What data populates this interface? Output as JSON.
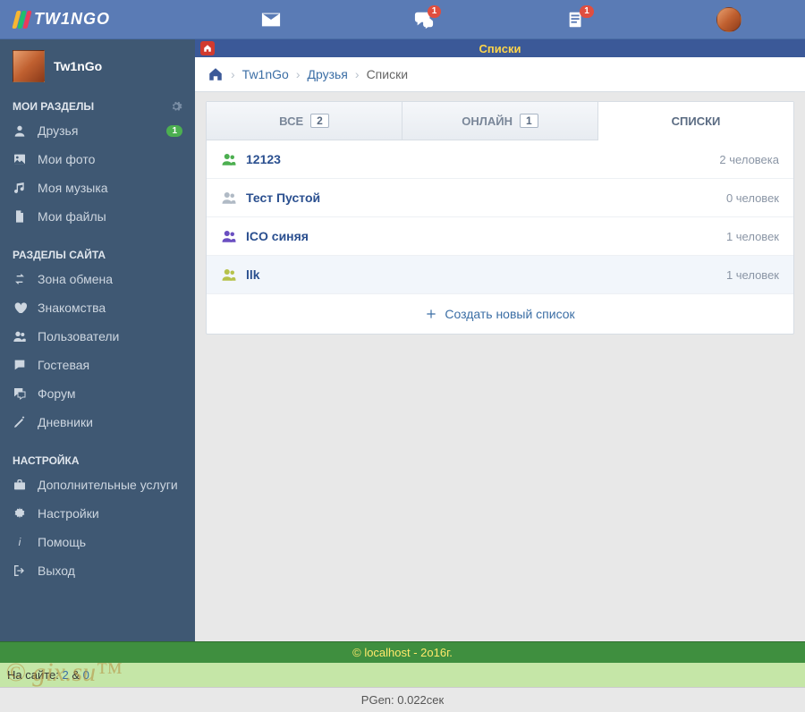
{
  "brand": "TW1NGO",
  "topnav": {
    "messages_badge": null,
    "chat_badge": "1",
    "feed_badge": "1"
  },
  "profile": {
    "name": "Tw1nGo"
  },
  "sidebar": {
    "section_my": "МОИ РАЗДЕЛЫ",
    "section_site": "РАЗДЕЛЫ САЙТА",
    "section_settings": "НАСТРОЙКА",
    "my": {
      "friends": {
        "label": "Друзья",
        "count": "1"
      },
      "photos": {
        "label": "Мои фото"
      },
      "music": {
        "label": "Моя музыка"
      },
      "files": {
        "label": "Мои файлы"
      }
    },
    "site": {
      "exchange": {
        "label": "Зона обмена"
      },
      "dating": {
        "label": "Знакомства"
      },
      "users": {
        "label": "Пользователи"
      },
      "guestbook": {
        "label": "Гостевая"
      },
      "forum": {
        "label": "Форум"
      },
      "diaries": {
        "label": "Дневники"
      }
    },
    "settings": {
      "extra": {
        "label": "Дополнительные услуги"
      },
      "settings": {
        "label": "Настройки"
      },
      "help": {
        "label": "Помощь"
      },
      "logout": {
        "label": "Выход"
      }
    }
  },
  "titlebar": "Списки",
  "breadcrumb": {
    "user": "Tw1nGo",
    "friends": "Друзья",
    "current": "Списки"
  },
  "tabs": {
    "all": {
      "label": "ВСЕ",
      "count": "2"
    },
    "online": {
      "label": "ОНЛАЙН",
      "count": "1"
    },
    "lists": {
      "label": "СПИСКИ"
    }
  },
  "lists": [
    {
      "name": "12123",
      "meta": "2 человека",
      "color": "green"
    },
    {
      "name": "Тест Пустой",
      "meta": "0 человек",
      "color": "grey"
    },
    {
      "name": "ICO синяя",
      "meta": "1 человек",
      "color": "purple"
    },
    {
      "name": "llk",
      "meta": "1 человек",
      "color": "olive",
      "alt": true
    }
  ],
  "create_list": "Создать новый список",
  "footer": {
    "copyright": "© localhost - 2o16г.",
    "online_prefix": "На сайте: ",
    "online_a": "2",
    "online_sep": " & ",
    "online_b": "0",
    "pgen": "PGen: 0.022сек",
    "watermark": "© gix.su™"
  }
}
